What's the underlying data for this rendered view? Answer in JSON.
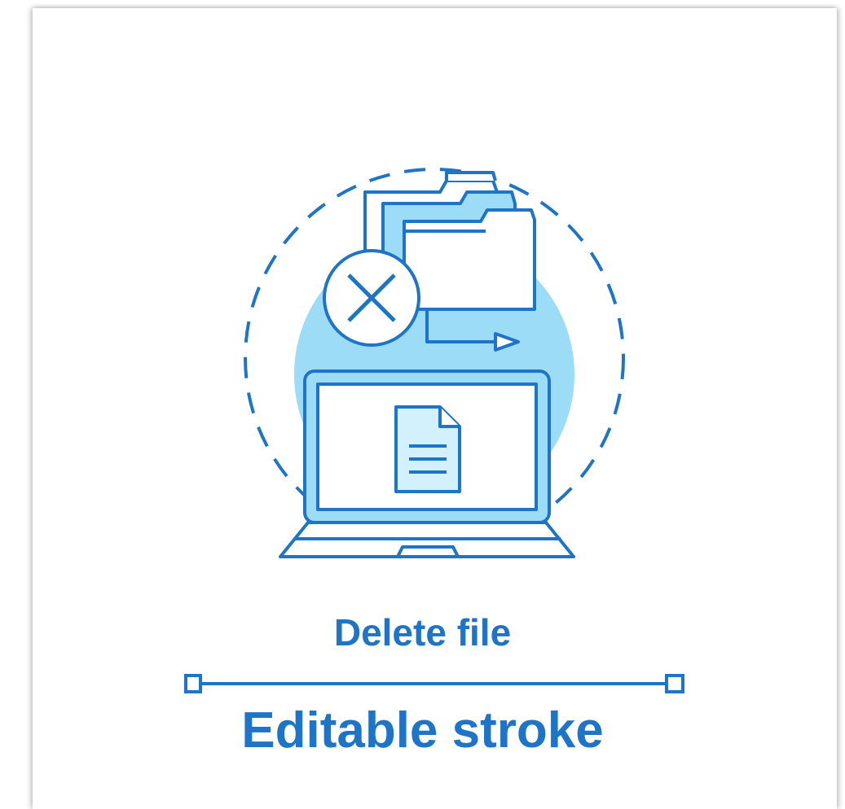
{
  "title": "Delete file",
  "subtitle": "Editable stroke",
  "icons": [
    "folder-icon",
    "delete-x-icon",
    "laptop-icon",
    "document-icon",
    "arrow-right-icon"
  ],
  "colors": {
    "stroke": "#1e74c6",
    "fill_light": "#9cdcf7",
    "fill_pale": "#d3f1fc",
    "text": "#1e74c6"
  }
}
